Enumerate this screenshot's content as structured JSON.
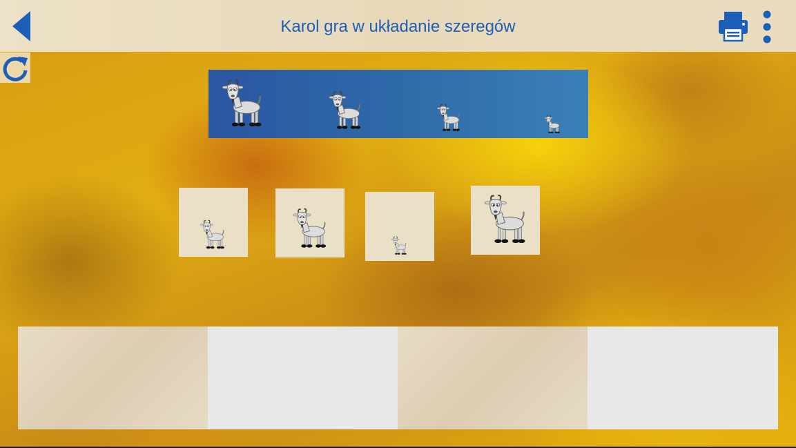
{
  "header": {
    "title": "Karol gra w układanie szeregów",
    "back_icon": "back-arrow-icon",
    "print_icon": "print-icon",
    "menu_icon": "more-vertical-icon",
    "icon_color": "#1d5fb8"
  },
  "toolbar": {
    "refresh_icon": "refresh-icon"
  },
  "reference_row": {
    "description_icon": "goat-icon",
    "order": [
      "largest",
      "large",
      "small",
      "smallest"
    ]
  },
  "tiles": [
    {
      "item": "goat",
      "size": "small"
    },
    {
      "item": "goat",
      "size": "large"
    },
    {
      "item": "goat",
      "size": "smallest"
    },
    {
      "item": "goat",
      "size": "largest"
    }
  ],
  "slots": [
    {
      "state": "empty"
    },
    {
      "state": "empty"
    },
    {
      "state": "empty"
    },
    {
      "state": "empty"
    }
  ],
  "colors": {
    "accent": "#1d5fb8",
    "strip": "#2f6aa8",
    "tile_bg": "#eae0c8",
    "slot_grey": "#e8e8e8"
  }
}
